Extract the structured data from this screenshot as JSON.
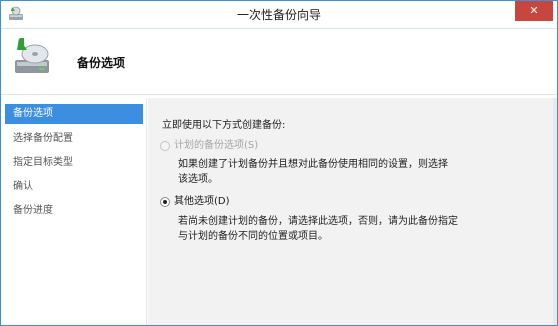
{
  "window": {
    "title": "一次性备份向导",
    "close_label": "✕"
  },
  "header": {
    "title": "备份选项"
  },
  "sidebar": {
    "items": [
      {
        "label": "备份选项",
        "active": true
      },
      {
        "label": "选择备份配置",
        "active": false
      },
      {
        "label": "指定目标类型",
        "active": false
      },
      {
        "label": "确认",
        "active": false
      },
      {
        "label": "备份进度",
        "active": false
      }
    ]
  },
  "main": {
    "prompt": "立即使用以下方式创建备份:",
    "options": [
      {
        "label": "计划的备份选项(S)",
        "selected": false,
        "enabled": false,
        "description": [
          "如果创建了计划备份并且想对此备份使用相同的设置，则选择",
          "该选项。"
        ]
      },
      {
        "label": "其他选项(D)",
        "selected": true,
        "enabled": true,
        "description": [
          "若尚未创建计划的备份，请选择此选项，否则，请为此备份指定",
          "与计划的备份不同的位置或项目。"
        ]
      }
    ]
  },
  "colors": {
    "accent": "#3c8fe0",
    "close": "#c7473e"
  }
}
